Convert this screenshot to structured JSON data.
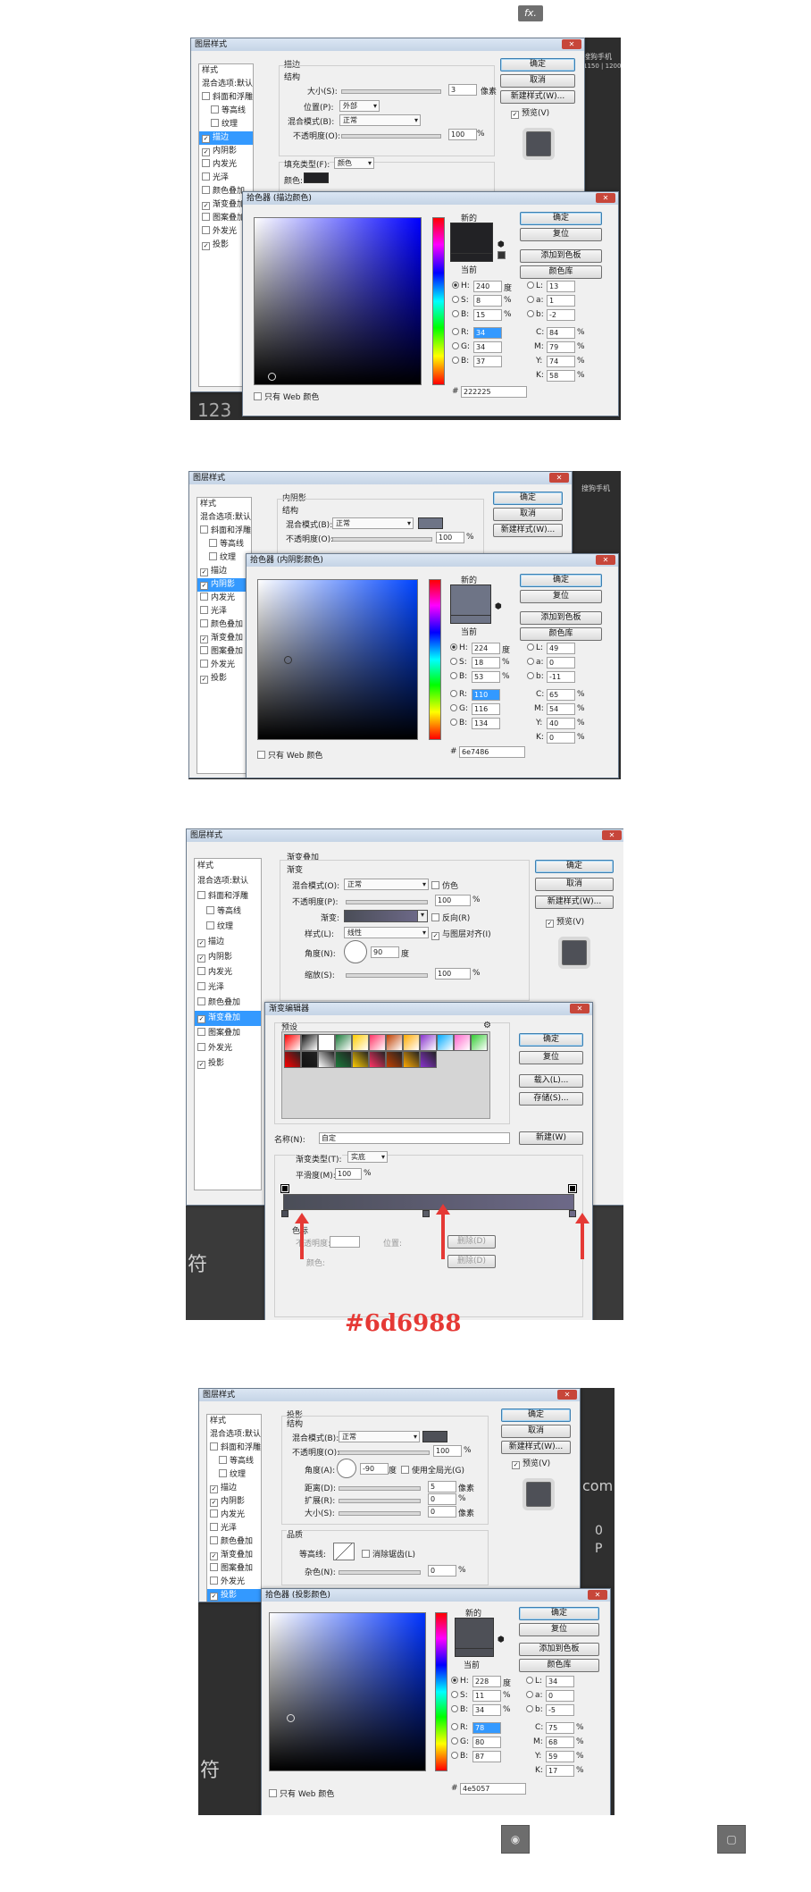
{
  "fx_label": "fx.",
  "window_title": "图层样式",
  "left_items": [
    "样式",
    "混合选项:默认",
    "斜面和浮雕",
    "等高线",
    "纹理",
    "描边",
    "内阴影",
    "内发光",
    "光泽",
    "颜色叠加",
    "渐变叠加",
    "图案叠加",
    "外发光",
    "投影"
  ],
  "buttons": {
    "ok": "确定",
    "cancel": "取消",
    "new_style": "新建样式(W)...",
    "preview": "预览(V)"
  },
  "bg_text": {
    "t1": "123",
    "t2": "符",
    "t3": "符",
    "t4": "com",
    "t5": "0",
    "t6": "P",
    "t7": "搜狗手机",
    "t8": "1150 | 1200"
  },
  "picker": {
    "new_label": "新的",
    "current_label": "当前",
    "ok": "确定",
    "reset": "复位",
    "add_swatch": "添加到色板",
    "libraries": "颜色库",
    "web_only": "只有 Web 颜色",
    "deg": "度",
    "pct": "%",
    "hash": "#"
  },
  "p1": {
    "section": "描边",
    "structure": "结构",
    "size_label": "大小(S):",
    "size": "3",
    "px": "像素",
    "pos_label": "位置(P):",
    "pos": "外部",
    "blend_label": "混合模式(B):",
    "blend": "正常",
    "opacity_label": "不透明度(O):",
    "opacity": "100",
    "fill_label": "填充类型(F):",
    "fill": "颜色",
    "color_label": "颜色:",
    "picker_title": "拾色器 (描边颜色)",
    "H": "240",
    "S": "8",
    "B": "15",
    "R": "34",
    "G": "34",
    "Bb": "37",
    "L": "13",
    "a": "1",
    "b": "-2",
    "C": "84",
    "M": "79",
    "Y": "74",
    "K": "58",
    "hex": "222225",
    "swatch": "#222225",
    "sv_hue": "#0000ff"
  },
  "p2": {
    "section": "内阴影",
    "structure": "结构",
    "blend_label": "混合模式(B):",
    "blend": "正常",
    "opacity_label": "不透明度(O):",
    "opacity": "100",
    "picker_title": "拾色器 (内阴影颜色)",
    "H": "224",
    "S": "18",
    "B": "53",
    "R": "110",
    "G": "116",
    "Bb": "134",
    "L": "49",
    "a": "0",
    "b": "-11",
    "C": "65",
    "M": "54",
    "Y": "40",
    "K": "0",
    "hex": "6e7486",
    "swatch": "#6e7486",
    "sv_hue": "#0044ff"
  },
  "p3": {
    "section": "渐变叠加",
    "sub": "渐变",
    "blend_label": "混合模式(O):",
    "blend": "正常",
    "dither": "仿色",
    "opacity_label": "不透明度(P):",
    "opacity": "100",
    "gradient_label": "渐变:",
    "reverse": "反向(R)",
    "style_label": "样式(L):",
    "style": "线性",
    "align": "与图层对齐(I)",
    "angle_label": "角度(N):",
    "angle": "90",
    "deg": "度",
    "scale_label": "缩放(S):",
    "scale": "100",
    "editor_title": "渐变编辑器",
    "presets": "预设",
    "ok": "确定",
    "reset": "复位",
    "load": "载入(L)...",
    "save": "存储(S)...",
    "name_label": "名称(N):",
    "name": "自定",
    "new": "新建(W)",
    "type_label": "渐变类型(T):",
    "type": "实底",
    "smooth_label": "平滑度(M):",
    "smooth": "100",
    "stops": "色标",
    "opacity_s": "不透明度:",
    "position": "位置:",
    "delete": "删除(D)",
    "color_s": "颜色:",
    "red_label": "#6d6988",
    "gradient_from": "#4a4d57",
    "gradient_to": "#6d6988"
  },
  "p4": {
    "section": "投影",
    "structure": "结构",
    "blend_label": "混合模式(B):",
    "blend": "正常",
    "opacity_label": "不透明度(O):",
    "opacity": "100",
    "angle_label": "角度(A):",
    "angle": "-90",
    "global": "使用全局光(G)",
    "dist_label": "距离(D):",
    "dist": "5",
    "spread_label": "扩展(R):",
    "spread": "0",
    "size_label": "大小(S):",
    "size": "0",
    "px": "像素",
    "quality": "品质",
    "contour_label": "等高线:",
    "antialias": "消除锯齿(L)",
    "noise_label": "杂色(N):",
    "noise": "0",
    "picker_title": "拾色器 (投影颜色)",
    "H": "228",
    "S": "11",
    "B": "34",
    "R": "78",
    "G": "80",
    "Bb": "87",
    "L": "34",
    "a": "0",
    "b": "-5",
    "C": "75",
    "M": "68",
    "Y": "59",
    "K": "17",
    "hex": "4e5057",
    "swatch": "#4e5057",
    "sv_hue": "#0033ff"
  },
  "gradient_presets": [
    "#ff0000",
    "#111111",
    "#ffffff",
    "#1b7a3a",
    "#ffcc00",
    "#ff3366",
    "#c04000",
    "#ffaa00",
    "#8833cc",
    "#00aaff",
    "#ff66cc",
    "#33cc33"
  ],
  "bottom_icons": {
    "eye": "◉",
    "square": "▢"
  }
}
